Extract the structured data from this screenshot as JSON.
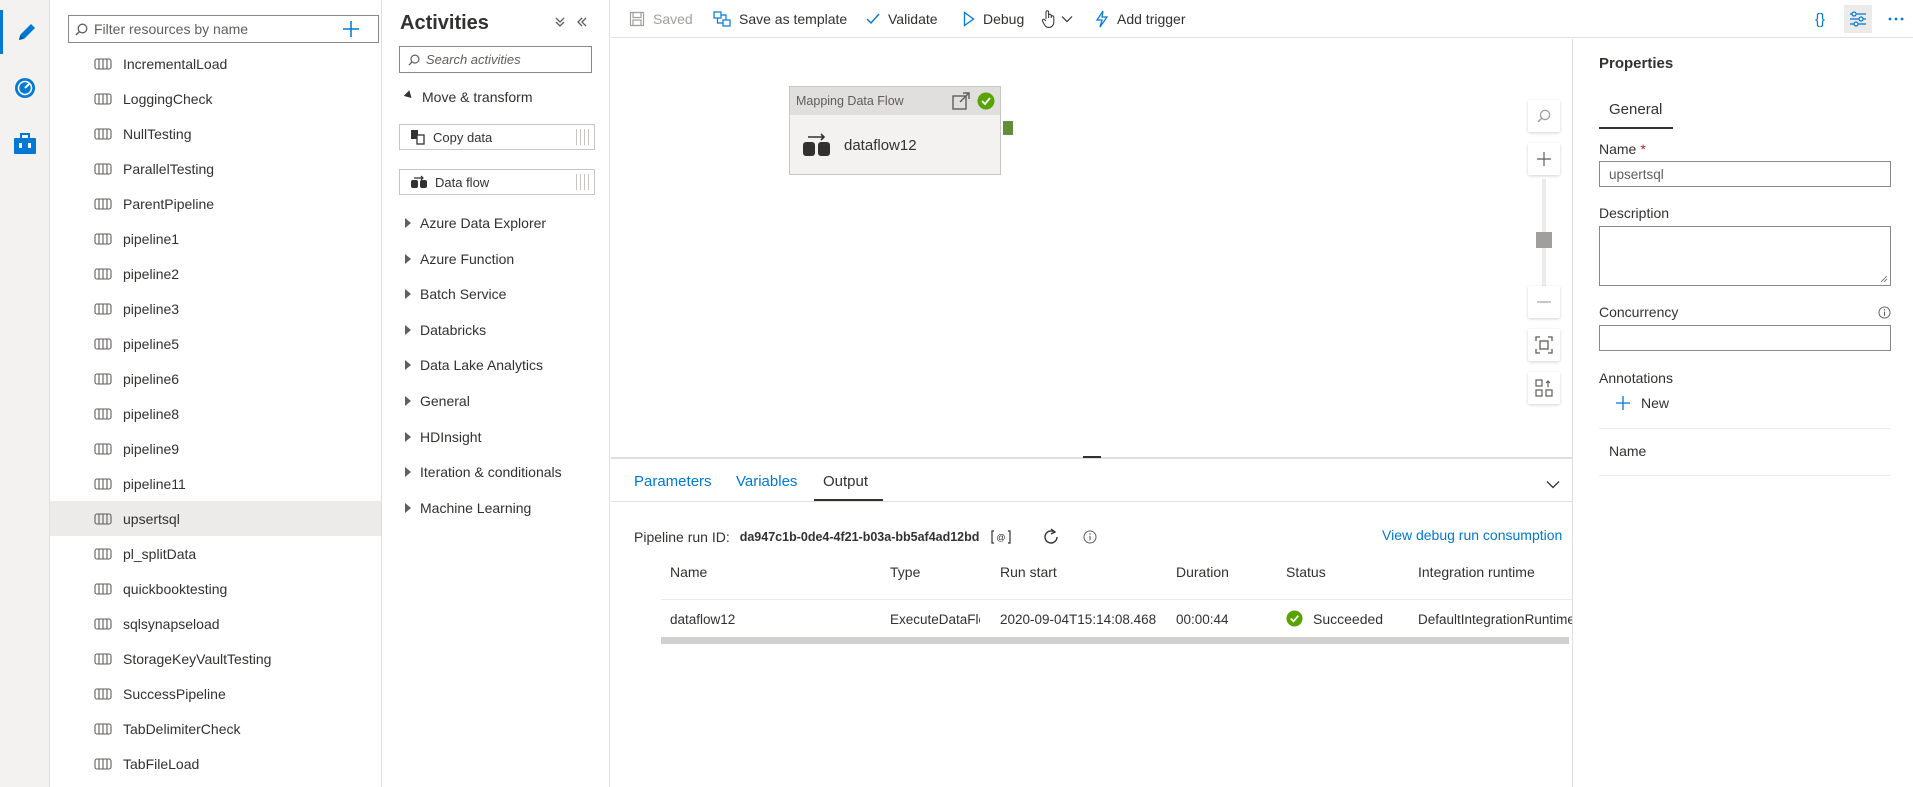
{
  "icons": {
    "rail": [
      "pencil-icon",
      "monitor-icon",
      "toolbox-icon"
    ],
    "accent": "#0078d4"
  },
  "tree": {
    "filter_placeholder": "Filter resources by name",
    "items": [
      "IncrementalLoad",
      "LoggingCheck",
      "NullTesting",
      "ParallelTesting",
      "ParentPipeline",
      "pipeline1",
      "pipeline2",
      "pipeline3",
      "pipeline5",
      "pipeline6",
      "pipeline8",
      "pipeline9",
      "pipeline11",
      "upsertsql",
      "pl_splitData",
      "quickbooktesting",
      "sqlsynapseload",
      "StorageKeyVaultTesting",
      "SuccessPipeline",
      "TabDelimiterCheck",
      "TabFileLoad"
    ],
    "selected": "upsertsql"
  },
  "activities": {
    "title": "Activities",
    "search_placeholder": "Search activities",
    "expanded_category": "Move & transform",
    "items": [
      "Copy data",
      "Data flow"
    ],
    "categories": [
      "Azure Data Explorer",
      "Azure Function",
      "Batch Service",
      "Databricks",
      "Data Lake Analytics",
      "General",
      "HDInsight",
      "Iteration & conditionals",
      "Machine Learning"
    ]
  },
  "toolbar": {
    "saved": "Saved",
    "save_template": "Save as template",
    "validate": "Validate",
    "debug": "Debug",
    "add_trigger": "Add trigger",
    "code_icon": "{}"
  },
  "canvas": {
    "node_type": "Mapping Data Flow",
    "node_name": "dataflow12",
    "status_color": "#57a300"
  },
  "bottom": {
    "tabs": [
      "Parameters",
      "Variables",
      "Output"
    ],
    "active_tab": "Output",
    "run_id_label": "Pipeline run ID:",
    "run_id": "da947c1b-0de4-4f21-b03a-bb5af4ad12bd",
    "debug_link": "View debug run consumption",
    "columns": [
      "Name",
      "Type",
      "Run start",
      "Duration",
      "Status",
      "Integration runtime"
    ],
    "row": {
      "name": "dataflow12",
      "type": "ExecuteDataFlow",
      "run_start": "2020-09-04T15:14:08.468",
      "duration": "00:00:44",
      "status": "Succeeded",
      "runtime": "DefaultIntegrationRuntime"
    }
  },
  "properties": {
    "title": "Properties",
    "tab": "General",
    "name_label": "Name",
    "required_mark": "*",
    "name_value": "upsertsql",
    "description_label": "Description",
    "concurrency_label": "Concurrency",
    "annotations_label": "Annotations",
    "new_label": "New",
    "name_column": "Name"
  }
}
